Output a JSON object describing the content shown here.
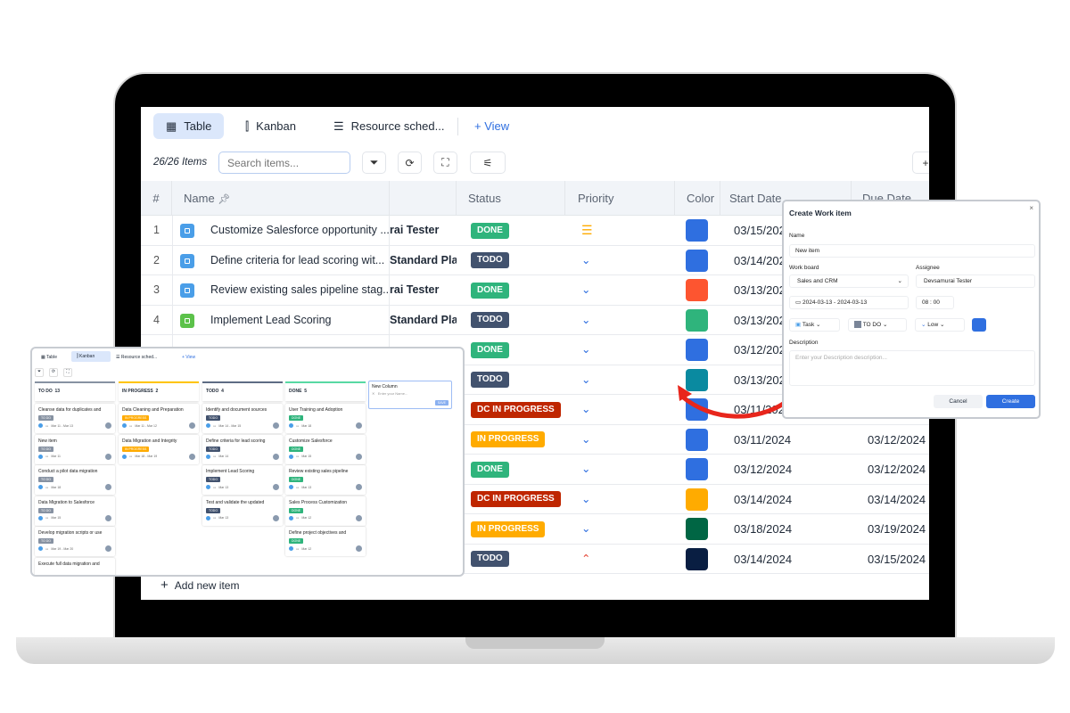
{
  "views": {
    "tabs": [
      {
        "label": "Table",
        "icon": "table-icon",
        "active": true
      },
      {
        "label": "Kanban",
        "icon": "kanban-icon"
      },
      {
        "label": "Resource sched...",
        "icon": "schedule-icon"
      }
    ],
    "add_view": "+ View"
  },
  "toolbar": {
    "count": "26/26 Items",
    "search_placeholder": "Search items..."
  },
  "table": {
    "columns": [
      "#",
      "Name",
      "",
      "Status",
      "Priority",
      "Color",
      "Start Date",
      "Due Date"
    ],
    "rows": [
      {
        "n": "1",
        "name": "Customize Salesforce opportunity ...",
        "assignee": "rai Tester",
        "status": "DONE",
        "priority": "medium",
        "color": "#2f6fe0",
        "start": "03/15/2024",
        "due": "",
        "icon": "#4a9ee8"
      },
      {
        "n": "2",
        "name": "Define criteria for lead scoring wit...",
        "assignee": "Standard Platf",
        "status": "TODO",
        "priority": "low",
        "color": "#2f6fe0",
        "start": "03/14/2024",
        "due": "",
        "icon": "#4a9ee8"
      },
      {
        "n": "3",
        "name": "Review existing sales pipeline stag...",
        "assignee": "rai Tester",
        "status": "DONE",
        "priority": "low",
        "color": "#fd5530",
        "start": "03/13/2024",
        "due": "",
        "icon": "#4a9ee8"
      },
      {
        "n": "4",
        "name": "Implement Lead Scoring",
        "assignee": "Standard Platf",
        "status": "TODO",
        "priority": "low",
        "color": "#2fb47c",
        "start": "03/13/2024",
        "due": "",
        "icon": "#5cc24a"
      },
      {
        "n": "",
        "name": "",
        "assignee": "",
        "status": "DONE",
        "priority": "low",
        "color": "#2f6fe0",
        "start": "03/12/2024",
        "due": "",
        "icon": ""
      },
      {
        "n": "",
        "name": "",
        "assignee": "",
        "status": "TODO",
        "priority": "low",
        "color": "#0a8aa0",
        "start": "03/13/2024",
        "due": "",
        "icon": ""
      },
      {
        "n": "",
        "name": "",
        "assignee": "",
        "status": "DC IN PROGRESS",
        "priority": "low",
        "color": "#2f6fe0",
        "start": "03/11/2024",
        "due": "",
        "icon": ""
      },
      {
        "n": "",
        "name": "",
        "assignee": "",
        "status": "IN PROGRESS",
        "priority": "low",
        "color": "#2f6fe0",
        "start": "03/11/2024",
        "due": "03/12/2024",
        "icon": ""
      },
      {
        "n": "",
        "name": "",
        "assignee": "",
        "status": "DONE",
        "priority": "low",
        "color": "#2f6fe0",
        "start": "03/12/2024",
        "due": "03/12/2024",
        "icon": ""
      },
      {
        "n": "",
        "name": "",
        "assignee": "",
        "status": "DC IN PROGRESS",
        "priority": "low",
        "color": "#ffab00",
        "start": "03/14/2024",
        "due": "03/14/2024",
        "icon": ""
      },
      {
        "n": "",
        "name": "",
        "assignee": "",
        "status": "IN PROGRESS",
        "priority": "low",
        "color": "#006644",
        "start": "03/18/2024",
        "due": "03/19/2024",
        "icon": ""
      },
      {
        "n": "",
        "name": "",
        "assignee": "",
        "status": "TODO",
        "priority": "high",
        "color": "#091e42",
        "start": "03/14/2024",
        "due": "03/15/2024",
        "icon": ""
      }
    ],
    "add_item": "Add new item"
  },
  "status_colors": {
    "DONE": "#2fb47c",
    "TODO": "#42526e",
    "DC IN PROGRESS": "#bf2600",
    "IN PROGRESS": "#ffab00"
  },
  "kanban": {
    "tabs": [
      "Table",
      "Kanban",
      "Resource sched..."
    ],
    "add_view": "+ View",
    "columns": [
      {
        "title": "TO DO",
        "count": "13",
        "color": "#8792a2",
        "cards": [
          {
            "title": "Cleanse data for duplicates and",
            "badge": "TO DO",
            "date": "Mar 11 - Mar 13"
          },
          {
            "title": "New item",
            "badge": "TO DO",
            "date": "Mar 11"
          },
          {
            "title": "Conduct a pilot data migration",
            "badge": "TO DO",
            "date": "Mar 18"
          },
          {
            "title": "Data Migration to Salesforce",
            "badge": "TO DO",
            "date": "Mar 15"
          },
          {
            "title": "Develop migration scripts or use",
            "badge": "TO DO",
            "date": "Mar 19 - Mar 20"
          },
          {
            "title": "Execute full data migration and",
            "badge": "",
            "date": ""
          }
        ]
      },
      {
        "title": "IN PROGRESS",
        "count": "2",
        "color": "#ffc400",
        "cards": [
          {
            "title": "Data Cleaning and Preparation",
            "badge": "IN PROGRESS",
            "date": "Mar 11 - Mar 12"
          },
          {
            "title": "Data Migration and Integrity",
            "badge": "IN PROGRESS",
            "date": "Mar 18 - Mar 19"
          }
        ]
      },
      {
        "title": "TODO",
        "count": "4",
        "color": "#5e6c84",
        "cards": [
          {
            "title": "Identify and document sources",
            "badge": "TODO",
            "date": "Mar 14 - Mar 15"
          },
          {
            "title": "Define criteria for lead scoring",
            "badge": "TODO",
            "date": "Mar 14"
          },
          {
            "title": "Implement Lead Scoring",
            "badge": "TODO",
            "date": "Mar 13"
          },
          {
            "title": "Test and validate the updated",
            "badge": "TODO",
            "date": "Mar 13"
          }
        ]
      },
      {
        "title": "DONE",
        "count": "5",
        "color": "#57d9a3",
        "cards": [
          {
            "title": "User Training and Adoption",
            "badge": "DONE",
            "date": "Mar 18"
          },
          {
            "title": "Customize Salesforce",
            "badge": "DONE",
            "date": "Mar 15"
          },
          {
            "title": "Review existing sales pipeline",
            "badge": "DONE",
            "date": "Mar 13"
          },
          {
            "title": "Sales Process Customization",
            "badge": "DONE",
            "date": "Mar 12"
          },
          {
            "title": "Define project objectives and",
            "badge": "DONE",
            "date": "Mar 12"
          }
        ]
      }
    ],
    "new_column": {
      "title": "New Column",
      "placeholder": "Enter your Name...",
      "save": "SAVE"
    },
    "badge_colors": {
      "TO DO": "#8792a2",
      "IN PROGRESS": "#ffab00",
      "TODO": "#42526e",
      "DONE": "#2fb47c"
    }
  },
  "dialog": {
    "title": "Create Work item",
    "name_label": "Name",
    "name_value": "New item",
    "board_label": "Work board",
    "board_value": "Sales and CRM",
    "assignee_label": "Assignee",
    "assignee_value": "Devsamurai Tester",
    "date_range": "2024-03-13 - 2024-03-13",
    "hour": "08",
    "minute": "00",
    "type": "Task",
    "status": "TO DO",
    "priority": "Low",
    "color": "#2f6fe0",
    "description_label": "Description",
    "description_placeholder": "Enter your Description description...",
    "cancel": "Cancel",
    "create": "Create"
  },
  "accent": "#2f6fe0",
  "arrow_color": "#e8261c"
}
